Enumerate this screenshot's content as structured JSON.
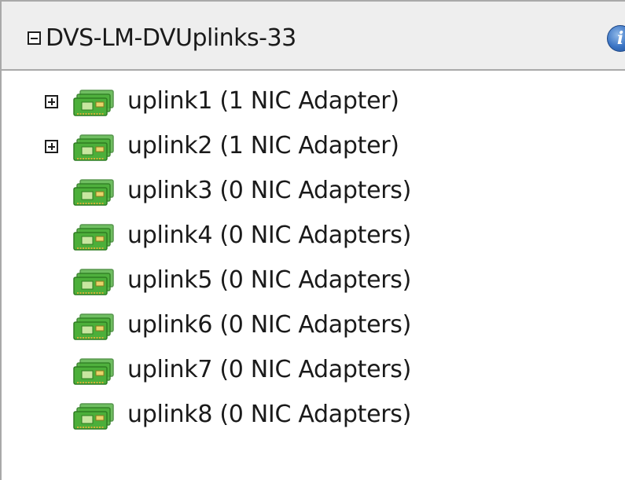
{
  "header": {
    "title": "DVS-LM-DVUplinks-33"
  },
  "uplinks": [
    {
      "label": "uplink1 (1 NIC Adapter)",
      "expandable": true
    },
    {
      "label": "uplink2 (1 NIC Adapter)",
      "expandable": true
    },
    {
      "label": "uplink3 (0 NIC Adapters)",
      "expandable": false
    },
    {
      "label": "uplink4 (0 NIC Adapters)",
      "expandable": false
    },
    {
      "label": "uplink5 (0 NIC Adapters)",
      "expandable": false
    },
    {
      "label": "uplink6 (0 NIC Adapters)",
      "expandable": false
    },
    {
      "label": "uplink7 (0 NIC Adapters)",
      "expandable": false
    },
    {
      "label": "uplink8 (0 NIC Adapters)",
      "expandable": false
    }
  ],
  "icons": {
    "header_toggle": "collapse-icon",
    "info": "info-icon",
    "row_toggle": "expand-icon",
    "row_icon": "nic-adapter-icon"
  },
  "colors": {
    "nic_green": "#4caf3a",
    "nic_dark": "#2e7d22",
    "header_bg": "#eeeeee",
    "border": "#a9a9a9",
    "info_blue": "#3a74c4"
  }
}
